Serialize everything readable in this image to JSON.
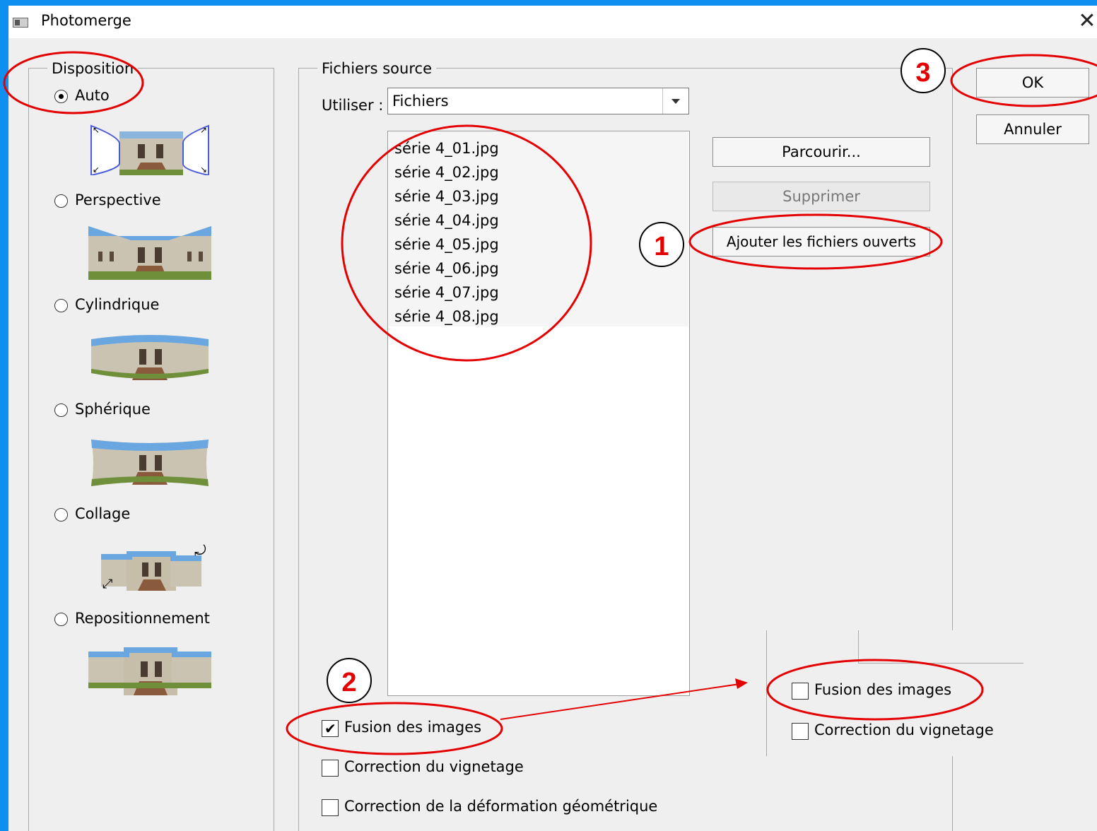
{
  "window": {
    "title": "Photomerge",
    "close_glyph": "✕"
  },
  "layout_group": {
    "legend": "Disposition",
    "options": [
      {
        "label": "Auto",
        "selected": true,
        "thumb": "auto-preview"
      },
      {
        "label": "Perspective",
        "selected": false,
        "thumb": "perspective-preview"
      },
      {
        "label": "Cylindrique",
        "selected": false,
        "thumb": "cylindrical-preview"
      },
      {
        "label": "Sphérique",
        "selected": false,
        "thumb": "spherical-preview"
      },
      {
        "label": "Collage",
        "selected": false,
        "thumb": "collage-preview"
      },
      {
        "label": "Repositionnement",
        "selected": false,
        "thumb": "reposition-preview"
      }
    ]
  },
  "source_group": {
    "legend": "Fichiers source",
    "use_label": "Utiliser :",
    "use_value": "Fichiers",
    "files": [
      "série 4_01.jpg",
      "série 4_02.jpg",
      "série 4_03.jpg",
      "série 4_04.jpg",
      "série 4_05.jpg",
      "série 4_06.jpg",
      "série 4_07.jpg",
      "série 4_08.jpg"
    ],
    "browse_label": "Parcourir...",
    "remove_label": "Supprimer",
    "add_open_label": "Ajouter les fichiers ouverts",
    "options": [
      {
        "label": "Fusion des images",
        "checked": true
      },
      {
        "label": "Correction du vignetage",
        "checked": false
      },
      {
        "label": "Correction de la déformation géométrique",
        "checked": false
      }
    ]
  },
  "dialog_buttons": {
    "ok_label": "OK",
    "cancel_label": "Annuler"
  },
  "inset": {
    "options": [
      {
        "label": "Fusion des images",
        "checked": false
      },
      {
        "label": "Correction du vignetage",
        "checked": false
      }
    ]
  },
  "annotations": {
    "badges": [
      "1",
      "2",
      "3"
    ],
    "color": "#e40000"
  }
}
